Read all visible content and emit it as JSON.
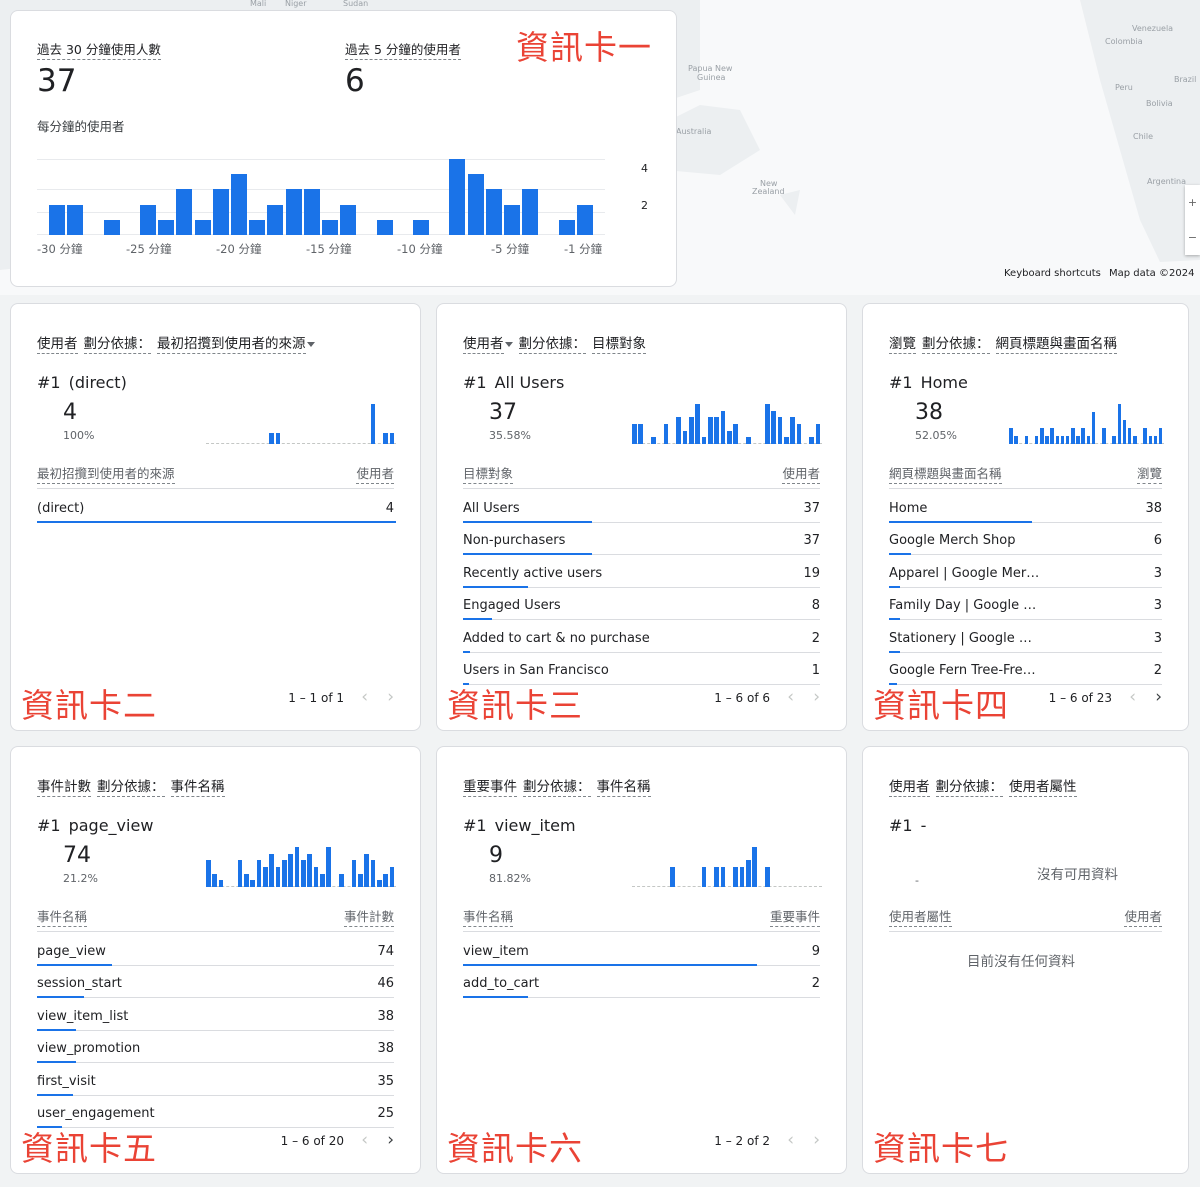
{
  "map": {
    "places": [
      "Mali",
      "Niger",
      "Sudan",
      "Venezuela",
      "Colombia",
      "Papua New",
      "Guinea",
      "Australia",
      "Peru",
      "Brazil",
      "Bolivia",
      "Chile",
      "Argentina",
      "New",
      "Zealand"
    ],
    "footer": {
      "shortcuts": "Keyboard shortcuts",
      "credit": "Map data ©2024"
    },
    "zoom": {
      "in": "+",
      "out": "−"
    }
  },
  "realtime": {
    "users30_label": "過去 30 分鐘使用人數",
    "users30_value": "37",
    "users5_label": "過去 5 分鐘的使用者",
    "users5_value": "6",
    "per_minute_label": "每分鐘的使用者",
    "y_ticks": [
      "4",
      "2"
    ],
    "x_ticks": [
      "-30 分鐘",
      "-25 分鐘",
      "-20 分鐘",
      "-15 分鐘",
      "-10 分鐘",
      "-5 分鐘",
      "-1 分鐘"
    ],
    "annotation": "資訊卡一"
  },
  "chart_data": {
    "type": "bar",
    "x": [
      -30,
      -29,
      -28,
      -27,
      -26,
      -25,
      -24,
      -23,
      -22,
      -21,
      -20,
      -19,
      -18,
      -17,
      -16,
      -15,
      -14,
      -13,
      -12,
      -11,
      -10,
      -9,
      -8,
      -7,
      -6,
      -5,
      -4,
      -3,
      -2,
      -1,
      0
    ],
    "values": [
      2,
      2,
      0,
      1,
      0,
      2,
      1,
      3,
      1,
      3,
      4,
      1,
      2,
      3,
      3,
      1,
      2,
      0,
      1,
      0,
      1,
      0,
      5,
      4,
      3,
      2,
      3,
      0,
      1,
      2,
      0
    ],
    "ylim": [
      0,
      5
    ],
    "y_ticks": [
      2,
      4
    ],
    "grid": true
  },
  "cards": [
    {
      "title_parts": [
        "使用者",
        "劃分依據：",
        "最初招攬到使用者的來源"
      ],
      "dropdown_after": 2,
      "rank": "#1",
      "top_name": "(direct)",
      "top_value": "4",
      "top_pct": "100%",
      "spark": [
        0,
        0,
        0,
        0,
        0,
        0,
        0,
        0,
        0,
        0,
        2,
        2,
        0,
        0,
        0,
        0,
        0,
        0,
        0,
        0,
        0,
        0,
        0,
        0,
        0,
        0,
        7,
        0,
        2,
        2
      ],
      "col_left": "最初招攬到使用者的來源",
      "col_right": "使用者",
      "rows": [
        {
          "name": "(direct)",
          "value": "4",
          "share": 1.0
        }
      ],
      "pager": "1 – 1 of 1",
      "next_enabled": false,
      "annotation": "資訊卡二"
    },
    {
      "title_parts": [
        "使用者",
        "劃分依據：",
        "目標對象"
      ],
      "dropdown_after": 0,
      "rank": "#1",
      "top_name": "All Users",
      "top_value": "37",
      "top_pct": "35.58%",
      "spark": [
        3,
        3,
        0,
        1,
        0,
        3,
        0,
        4,
        2,
        4,
        6,
        1,
        4,
        4,
        5,
        2,
        3,
        0,
        1,
        0,
        0,
        6,
        5,
        4,
        1,
        4,
        3,
        0,
        1,
        3
      ],
      "col_left": "目標對象",
      "col_right": "使用者",
      "rows": [
        {
          "name": "All Users",
          "value": "37",
          "share": 0.36
        },
        {
          "name": "Non-purchasers",
          "value": "37",
          "share": 0.36
        },
        {
          "name": "Recently active users",
          "value": "19",
          "share": 0.18
        },
        {
          "name": "Engaged Users",
          "value": "8",
          "share": 0.08
        },
        {
          "name": "Added to cart & no purchase",
          "value": "2",
          "share": 0.02
        },
        {
          "name": "Users in San Francisco",
          "value": "1",
          "share": 0.01
        }
      ],
      "pager": "1 – 6 of 6",
      "next_enabled": false,
      "annotation": "資訊卡三"
    },
    {
      "title_parts": [
        "瀏覽",
        "劃分依據：",
        "網頁標題與畫面名稱"
      ],
      "dropdown_after": -1,
      "rank": "#1",
      "top_name": "Home",
      "top_value": "38",
      "top_pct": "52.05%",
      "spark": [
        2,
        1,
        0,
        1,
        0,
        1,
        2,
        1,
        2,
        1,
        1,
        1,
        2,
        1,
        2,
        1,
        4,
        0,
        2,
        0,
        1,
        5,
        3,
        2,
        1,
        0,
        2,
        1,
        1,
        2
      ],
      "col_left": "網頁標題與畫面名稱",
      "col_right": "瀏覽",
      "rows": [
        {
          "name": "Home",
          "value": "38",
          "share": 0.52
        },
        {
          "name": "Google Merch Shop",
          "value": "6",
          "share": 0.08
        },
        {
          "name": "Apparel | Google Mer…",
          "value": "3",
          "share": 0.04
        },
        {
          "name": "Family Day | Google …",
          "value": "3",
          "share": 0.04
        },
        {
          "name": "Stationery | Google …",
          "value": "3",
          "share": 0.04
        },
        {
          "name": "Google Fern Tree-Fre…",
          "value": "2",
          "share": 0.03
        }
      ],
      "pager": "1 – 6 of 23",
      "next_enabled": true,
      "annotation": "資訊卡四"
    },
    {
      "title_parts": [
        "事件計數",
        "劃分依據：",
        "事件名稱"
      ],
      "dropdown_after": -1,
      "rank": "#1",
      "top_name": "page_view",
      "top_value": "74",
      "top_pct": "21.2%",
      "spark": [
        4,
        2,
        1,
        0,
        0,
        4,
        2,
        1,
        4,
        3,
        5,
        3,
        4,
        5,
        6,
        4,
        5,
        3,
        2,
        6,
        0,
        2,
        0,
        4,
        2,
        5,
        4,
        1,
        2,
        3
      ],
      "col_left": "事件名稱",
      "col_right": "事件計數",
      "rows": [
        {
          "name": "page_view",
          "value": "74",
          "share": 0.21
        },
        {
          "name": "session_start",
          "value": "46",
          "share": 0.13
        },
        {
          "name": "view_item_list",
          "value": "38",
          "share": 0.11
        },
        {
          "name": "view_promotion",
          "value": "38",
          "share": 0.11
        },
        {
          "name": "first_visit",
          "value": "35",
          "share": 0.1
        },
        {
          "name": "user_engagement",
          "value": "25",
          "share": 0.07
        }
      ],
      "pager": "1 – 6 of 20",
      "next_enabled": true,
      "annotation": "資訊卡五"
    },
    {
      "title_parts": [
        "重要事件",
        "劃分依據：",
        "事件名稱"
      ],
      "dropdown_after": -1,
      "rank": "#1",
      "top_name": "view_item",
      "top_value": "9",
      "top_pct": "81.82%",
      "spark": [
        0,
        0,
        0,
        0,
        0,
        0,
        3,
        0,
        0,
        0,
        0,
        3,
        0,
        3,
        3,
        0,
        3,
        3,
        4,
        6,
        0,
        3,
        0,
        0,
        0,
        0,
        0,
        0,
        0,
        0
      ],
      "col_left": "事件名稱",
      "col_right": "重要事件",
      "rows": [
        {
          "name": "view_item",
          "value": "9",
          "share": 0.82
        },
        {
          "name": "add_to_cart",
          "value": "2",
          "share": 0.18
        }
      ],
      "pager": "1 – 2 of 2",
      "next_enabled": false,
      "annotation": "資訊卡六"
    },
    {
      "title_parts": [
        "使用者",
        "劃分依據：",
        "使用者屬性"
      ],
      "dropdown_after": -1,
      "rank": "#1",
      "top_name": "-",
      "top_value": "",
      "top_pct": "-",
      "spark": [],
      "no_chart_text": "沒有可用資料",
      "col_left": "使用者屬性",
      "col_right": "使用者",
      "rows": [],
      "empty_text": "目前沒有任何資料",
      "pager": "",
      "next_enabled": false,
      "annotation": "資訊卡七"
    }
  ]
}
